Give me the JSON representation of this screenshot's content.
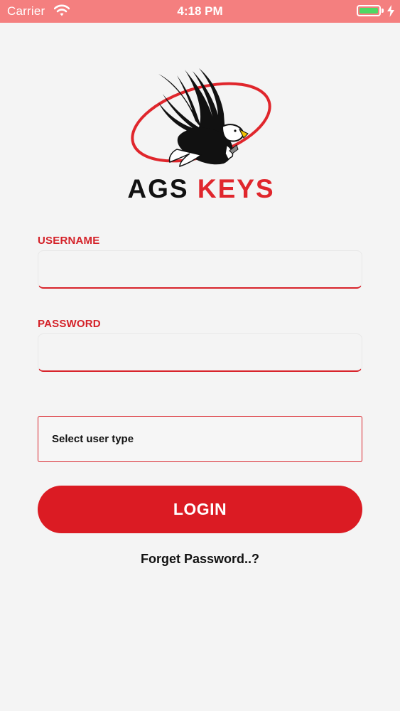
{
  "status_bar": {
    "carrier": "Carrier",
    "time": "4:18 PM",
    "battery_level": 1.0,
    "charging": true
  },
  "brand": {
    "part1": "AGS",
    "part2": "KEYS",
    "accent_color": "#e0262c",
    "logo_icon": "eagle-icon"
  },
  "form": {
    "username_label": "USERNAME",
    "username_value": "",
    "password_label": "PASSWORD",
    "password_value": "",
    "user_type_placeholder": "Select user type",
    "login_label": "LOGIN",
    "forget_password": "Forget Password..?"
  },
  "colors": {
    "status_bar": "#f47f7f",
    "primary": "#db1b23",
    "background": "#f4f4f4"
  }
}
